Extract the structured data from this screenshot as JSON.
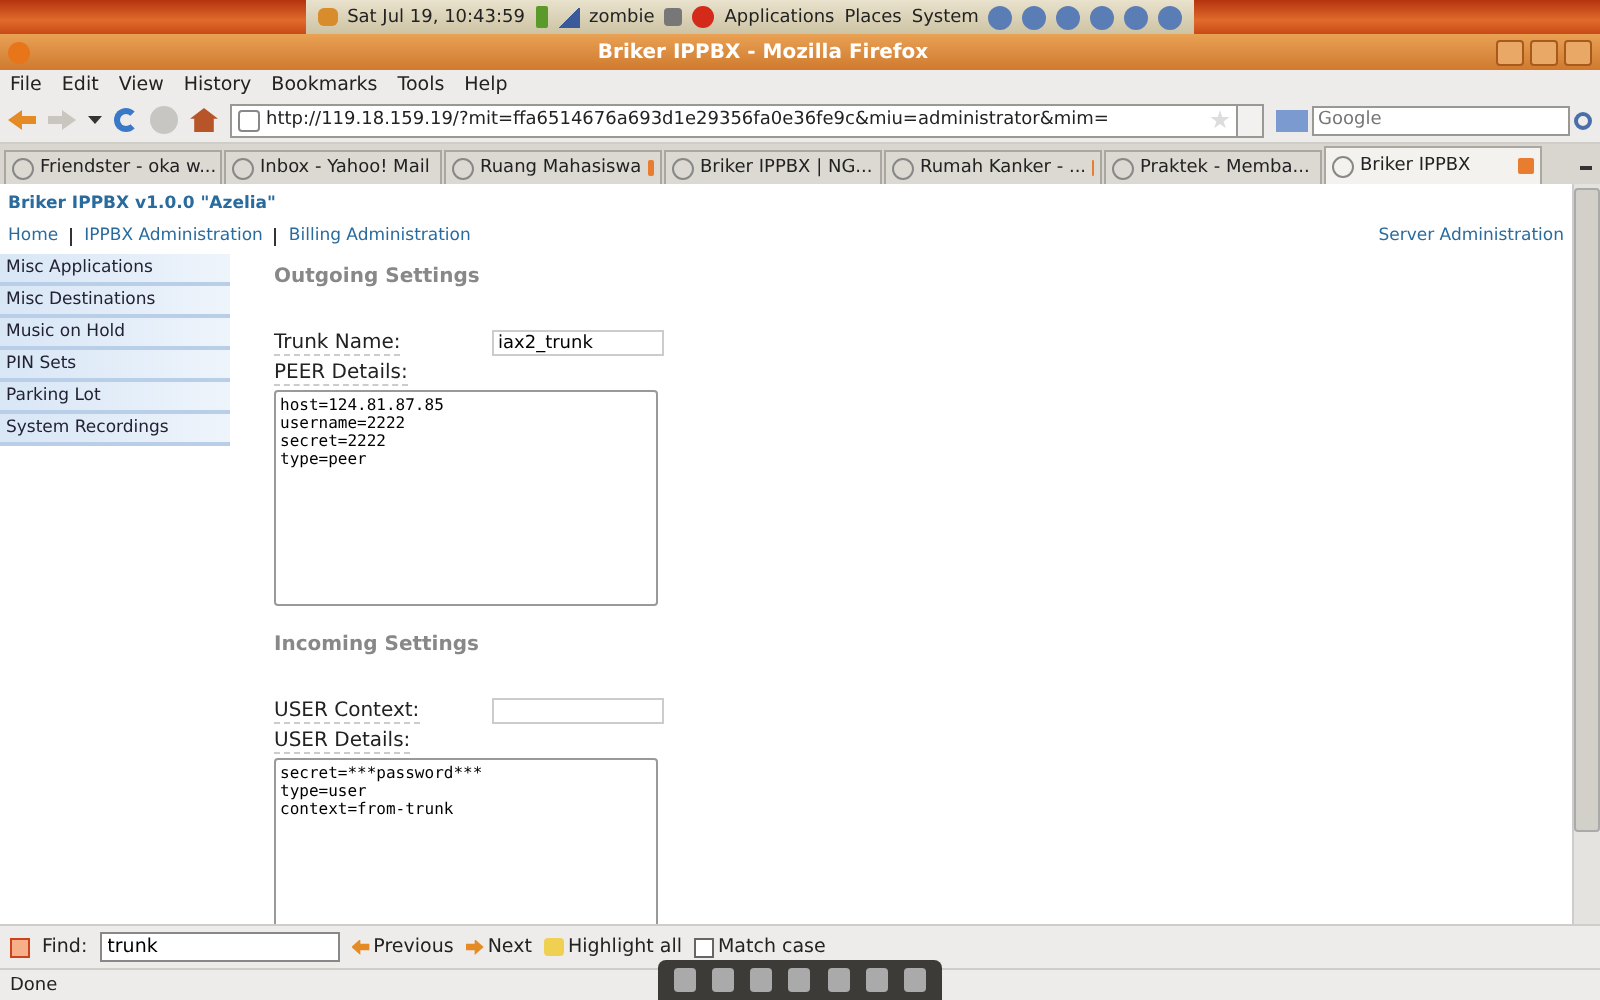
{
  "top_panel": {
    "clock": "Sat Jul 19, 10:43:59",
    "user": "zombie",
    "menus": [
      "Applications",
      "Places",
      "System"
    ]
  },
  "window": {
    "title": "Briker IPPBX - Mozilla Firefox"
  },
  "menu_bar": [
    "File",
    "Edit",
    "View",
    "History",
    "Bookmarks",
    "Tools",
    "Help"
  ],
  "toolbar": {
    "url": "http://119.18.159.19/?mit=ffa6514676a693d1e29356fa0e36fe9c&miu=administrator&mim=",
    "search": {
      "placeholder": "Google"
    }
  },
  "tabs": [
    {
      "label": "Friendster - oka w...",
      "selected": false
    },
    {
      "label": "Inbox - Yahoo! Mail",
      "selected": false
    },
    {
      "label": "Ruang Mahasiswa",
      "selected": false
    },
    {
      "label": "Briker IPPBX | NG...",
      "selected": false
    },
    {
      "label": "Rumah Kanker - ...",
      "selected": false
    },
    {
      "label": "Praktek - Memba...",
      "selected": false
    },
    {
      "label": "Briker IPPBX",
      "selected": true
    }
  ],
  "page": {
    "brand": "Briker IPPBX v1.0.0 \"Azelia\"",
    "nav": [
      "Home",
      "IPPBX Administration",
      "Billing Administration"
    ],
    "nav_right": "Server Administration",
    "sidebar": {
      "items": [
        "Misc Applications",
        "Misc Destinations",
        "Music on Hold",
        "PIN Sets",
        "Parking Lot",
        "System Recordings"
      ]
    },
    "sections": [
      {
        "heading": "Outgoing Settings",
        "field_label": "Trunk Name:",
        "field_value": "iax2_trunk",
        "details_label": "PEER Details:",
        "details": "host=124.81.87.85\nusername=2222\nsecret=2222\ntype=peer"
      },
      {
        "heading": "Incoming Settings",
        "field_label": "USER Context:",
        "details_label": "USER Details:",
        "details": "secret=***password***\ntype=user\ncontext=from-trunk"
      }
    ]
  },
  "find_bar": {
    "label": "Find:",
    "value": "trunk",
    "previous": "Previous",
    "next": "Next",
    "highlight": "Highlight all",
    "match_case": {
      "label": "Match case",
      "checked": false
    }
  },
  "status_bar": "Done"
}
